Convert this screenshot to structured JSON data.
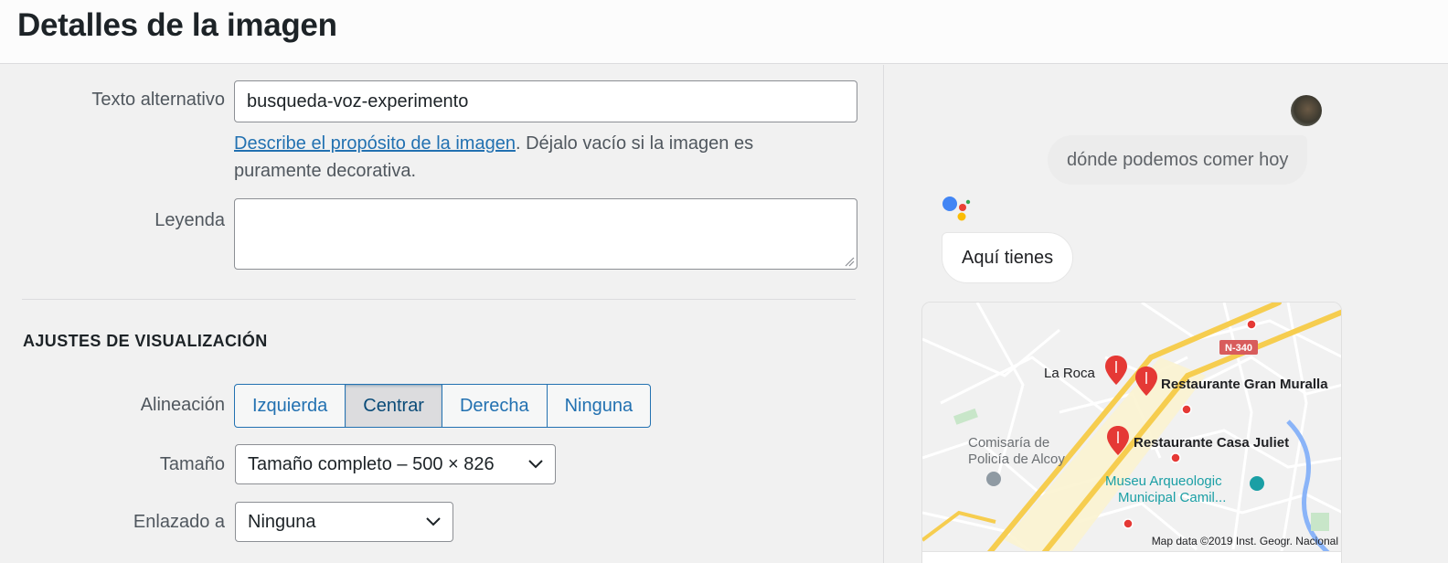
{
  "header": {
    "title": "Detalles de la imagen"
  },
  "form": {
    "alt_label": "Texto alternativo",
    "alt_value": "busqueda-voz-experimento",
    "help_link": "Describe el propósito de la imagen",
    "help_text": ". Déjalo vacío si la imagen es puramente decorativa.",
    "caption_label": "Leyenda",
    "caption_value": ""
  },
  "display": {
    "section_title": "AJUSTES DE VISUALIZACIÓN",
    "align_label": "Alineación",
    "align_options": [
      "Izquierda",
      "Centrar",
      "Derecha",
      "Ninguna"
    ],
    "align_selected": "Centrar",
    "size_label": "Tamaño",
    "size_value": "Tamaño completo – 500 × 826",
    "link_label": "Enlazado a",
    "link_value": "Ninguna"
  },
  "preview": {
    "user_query": "dónde podemos comer hoy",
    "assistant_reply": "Aquí tienes",
    "map": {
      "road_badge": "N-340",
      "places": [
        "La Roca",
        "Restaurante Gran Muralla",
        "Restaurante Casa Juliet",
        "Comisaría de",
        "Policía de Alcoy",
        "Museu Arqueologic",
        "Municipal Camil..."
      ],
      "attribution": "Map data ©2019 Inst. Geogr. Nacional"
    }
  },
  "colors": {
    "accent": "#2271b1",
    "google_blue": "#4285f4",
    "google_red": "#ea4335",
    "google_yellow": "#fbbc05",
    "google_green": "#34a853",
    "pin_red": "#e53935"
  }
}
